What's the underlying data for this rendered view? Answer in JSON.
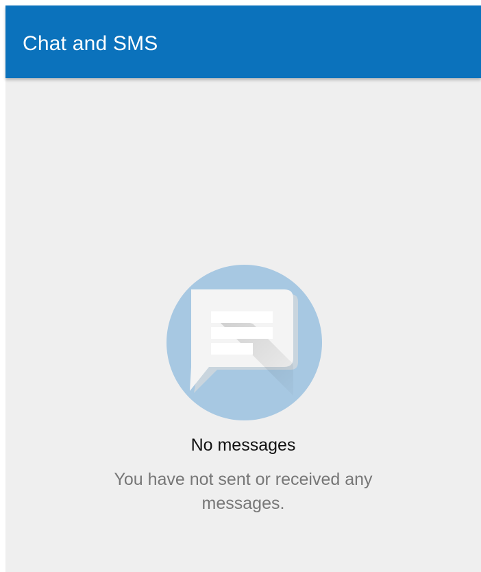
{
  "header": {
    "title": "Chat and SMS"
  },
  "empty_state": {
    "icon": "chat-bubble-icon",
    "title": "No messages",
    "subtitle": "You have not sent or received any messages."
  },
  "colors": {
    "app_bar": "#0b72bc",
    "background": "#efefef",
    "icon_circle": "#a7c8e2",
    "bubble": "#f4f4f4",
    "title_text": "#111111",
    "subtitle_text": "#777777"
  }
}
